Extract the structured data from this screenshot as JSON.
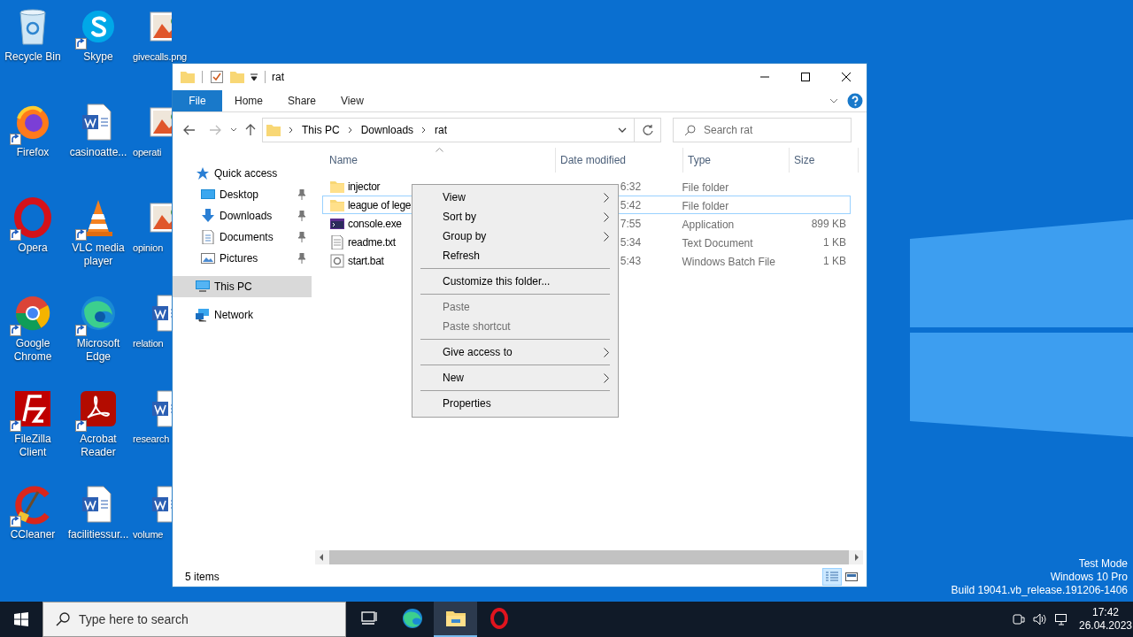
{
  "desktop_icons": [
    {
      "label": "Recycle Bin",
      "kind": "recycle",
      "shortcut": false
    },
    {
      "label": "Skype",
      "kind": "skype",
      "shortcut": true
    },
    {
      "label": "givecalls.png",
      "kind": "image",
      "shortcut": false
    },
    {
      "label": "Firefox",
      "kind": "firefox",
      "shortcut": true
    },
    {
      "label": "casinoatte...",
      "kind": "word",
      "shortcut": false
    },
    {
      "label": "operati",
      "kind": "image",
      "shortcut": false
    },
    {
      "label": "Opera",
      "kind": "opera",
      "shortcut": true
    },
    {
      "label": "VLC media player",
      "kind": "vlc",
      "shortcut": true
    },
    {
      "label": "opinion",
      "kind": "image",
      "shortcut": false
    },
    {
      "label": "Google Chrome",
      "kind": "chrome",
      "shortcut": true
    },
    {
      "label": "Microsoft Edge",
      "kind": "edge",
      "shortcut": true
    },
    {
      "label": "relation",
      "kind": "word",
      "shortcut": false
    },
    {
      "label": "FileZilla Client",
      "kind": "filezilla",
      "shortcut": true
    },
    {
      "label": "Acrobat Reader",
      "kind": "acrobat",
      "shortcut": true
    },
    {
      "label": "research",
      "kind": "word",
      "shortcut": false
    },
    {
      "label": "CCleaner",
      "kind": "ccleaner",
      "shortcut": true
    },
    {
      "label": "facilitiessur...",
      "kind": "word",
      "shortcut": false
    },
    {
      "label": "volume",
      "kind": "word",
      "shortcut": false
    }
  ],
  "explorer": {
    "title": "rat",
    "ribbon_tabs": [
      {
        "label": "File",
        "kind": "backstage"
      },
      {
        "label": "Home",
        "kind": "tab"
      },
      {
        "label": "Share",
        "kind": "tab"
      },
      {
        "label": "View",
        "kind": "tab"
      }
    ],
    "breadcrumbs": [
      "This PC",
      "Downloads",
      "rat"
    ],
    "search": {
      "placeholder": "Search rat"
    },
    "nav": [
      {
        "label": "Quick access",
        "kind": "star",
        "selected": false,
        "children": [
          {
            "label": "Desktop",
            "kind": "desktop",
            "pinned": true,
            "selected": false
          },
          {
            "label": "Downloads",
            "kind": "download",
            "pinned": true,
            "selected": false
          },
          {
            "label": "Documents",
            "kind": "document",
            "pinned": true,
            "selected": false
          },
          {
            "label": "Pictures",
            "kind": "pictures",
            "pinned": true,
            "selected": false
          }
        ]
      },
      {
        "label": "This PC",
        "kind": "pc",
        "selected": true
      },
      {
        "label": "Network",
        "kind": "network",
        "selected": false
      }
    ],
    "columns": [
      {
        "label": "Name",
        "sorted": true
      },
      {
        "label": "Date modified",
        "sorted": false
      },
      {
        "label": "Type",
        "sorted": false
      },
      {
        "label": "Size",
        "sorted": false
      }
    ],
    "rows": [
      {
        "name": "injector",
        "kind": "folder",
        "date": "6:32",
        "type": "File folder",
        "focused": false
      },
      {
        "name": "league of lege",
        "kind": "folder",
        "date": "5:42",
        "type": "File folder",
        "focused": true
      },
      {
        "name": "console.exe",
        "kind": "console",
        "date": "7:55",
        "type": "Application",
        "size": "899 KB",
        "focused": false
      },
      {
        "name": "readme.txt",
        "kind": "text",
        "date": "5:34",
        "type": "Text Document",
        "size": "1 KB",
        "focused": false
      },
      {
        "name": "start.bat",
        "kind": "batch",
        "date": "5:43",
        "type": "Windows Batch File",
        "size": "1 KB",
        "focused": false
      }
    ],
    "status": "5 items"
  },
  "context_menu": [
    {
      "kind": "item",
      "label": "View",
      "submenu": true,
      "disabled": false
    },
    {
      "kind": "item",
      "label": "Sort by",
      "submenu": true,
      "disabled": false
    },
    {
      "kind": "item",
      "label": "Group by",
      "submenu": true,
      "disabled": false
    },
    {
      "kind": "item",
      "label": "Refresh",
      "submenu": false,
      "disabled": false
    },
    {
      "kind": "separator"
    },
    {
      "kind": "item",
      "label": "Customize this folder...",
      "submenu": false,
      "disabled": false
    },
    {
      "kind": "separator"
    },
    {
      "kind": "item",
      "label": "Paste",
      "submenu": false,
      "disabled": true
    },
    {
      "kind": "item",
      "label": "Paste shortcut",
      "submenu": false,
      "disabled": true
    },
    {
      "kind": "separator"
    },
    {
      "kind": "item",
      "label": "Give access to",
      "submenu": true,
      "disabled": false
    },
    {
      "kind": "separator"
    },
    {
      "kind": "item",
      "label": "New",
      "submenu": true,
      "disabled": false
    },
    {
      "kind": "separator"
    },
    {
      "kind": "item",
      "label": "Properties",
      "submenu": false,
      "disabled": false
    }
  ],
  "watermark": [
    "Test Mode",
    "Windows 10 Pro",
    "Build 19041.vb_release.191206-1406"
  ],
  "taskbar": {
    "search_placeholder": "Type here to search",
    "apps": [
      {
        "kind": "taskview",
        "selected": false
      },
      {
        "kind": "edge",
        "selected": false
      },
      {
        "kind": "explorer",
        "selected": true
      },
      {
        "kind": "opera",
        "selected": false
      }
    ],
    "time": "17:42",
    "date": "26.04.2023"
  }
}
